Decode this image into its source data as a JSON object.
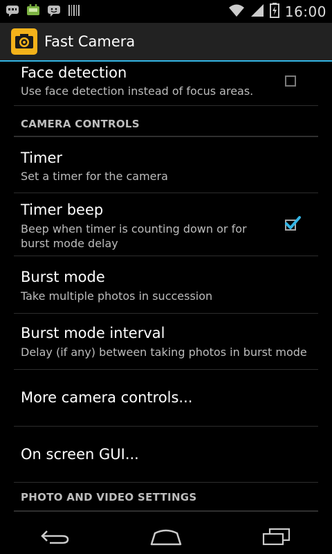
{
  "status_bar": {
    "time": "16:00",
    "left_icons": [
      "messaging-icon",
      "android-icon",
      "chat-icon",
      "barcode-icon"
    ],
    "right_icons": [
      "wifi-icon",
      "signal-icon",
      "battery-icon"
    ]
  },
  "action_bar": {
    "title": "Fast Camera",
    "app_icon": "camera-icon",
    "accent_color": "#33b5e5",
    "icon_color": "#f4b21a"
  },
  "preferences": {
    "face_detection": {
      "title": "Face detection",
      "summary": "Use face detection instead of focus areas.",
      "checked": false
    },
    "camera_controls_header": "CAMERA CONTROLS",
    "timer": {
      "title": "Timer",
      "summary": "Set a timer for the camera"
    },
    "timer_beep": {
      "title": "Timer beep",
      "summary": "Beep when timer is counting down or for burst mode delay",
      "checked": true
    },
    "burst_mode": {
      "title": "Burst mode",
      "summary": "Take multiple photos in succession"
    },
    "burst_mode_interval": {
      "title": "Burst mode interval",
      "summary": "Delay (if any) between taking photos in burst mode"
    },
    "more_camera_controls": {
      "title": "More camera controls..."
    },
    "on_screen_gui": {
      "title": "On screen GUI..."
    },
    "photo_video_header": "PHOTO AND VIDEO SETTINGS"
  },
  "nav_bar": {
    "buttons": [
      "back-icon",
      "home-icon",
      "recent-apps-icon"
    ]
  }
}
